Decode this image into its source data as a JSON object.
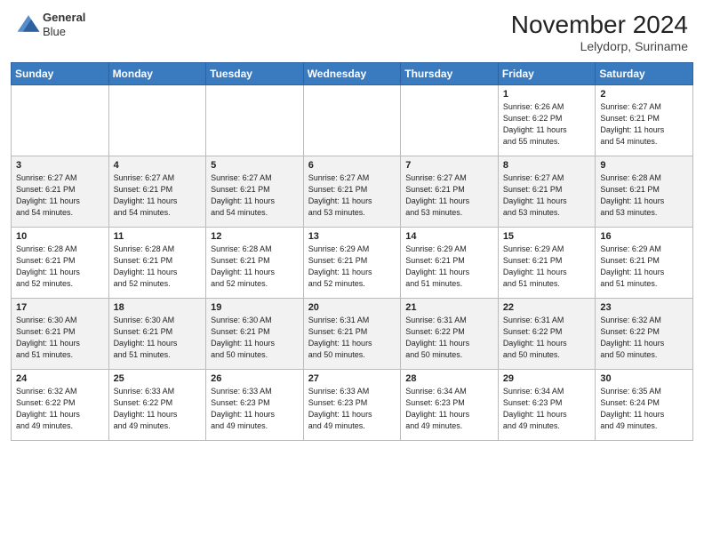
{
  "header": {
    "logo_line1": "General",
    "logo_line2": "Blue",
    "month_year": "November 2024",
    "location": "Lelydorp, Suriname"
  },
  "weekdays": [
    "Sunday",
    "Monday",
    "Tuesday",
    "Wednesday",
    "Thursday",
    "Friday",
    "Saturday"
  ],
  "weeks": [
    [
      {
        "day": "",
        "info": ""
      },
      {
        "day": "",
        "info": ""
      },
      {
        "day": "",
        "info": ""
      },
      {
        "day": "",
        "info": ""
      },
      {
        "day": "",
        "info": ""
      },
      {
        "day": "1",
        "info": "Sunrise: 6:26 AM\nSunset: 6:22 PM\nDaylight: 11 hours\nand 55 minutes."
      },
      {
        "day": "2",
        "info": "Sunrise: 6:27 AM\nSunset: 6:21 PM\nDaylight: 11 hours\nand 54 minutes."
      }
    ],
    [
      {
        "day": "3",
        "info": "Sunrise: 6:27 AM\nSunset: 6:21 PM\nDaylight: 11 hours\nand 54 minutes."
      },
      {
        "day": "4",
        "info": "Sunrise: 6:27 AM\nSunset: 6:21 PM\nDaylight: 11 hours\nand 54 minutes."
      },
      {
        "day": "5",
        "info": "Sunrise: 6:27 AM\nSunset: 6:21 PM\nDaylight: 11 hours\nand 54 minutes."
      },
      {
        "day": "6",
        "info": "Sunrise: 6:27 AM\nSunset: 6:21 PM\nDaylight: 11 hours\nand 53 minutes."
      },
      {
        "day": "7",
        "info": "Sunrise: 6:27 AM\nSunset: 6:21 PM\nDaylight: 11 hours\nand 53 minutes."
      },
      {
        "day": "8",
        "info": "Sunrise: 6:27 AM\nSunset: 6:21 PM\nDaylight: 11 hours\nand 53 minutes."
      },
      {
        "day": "9",
        "info": "Sunrise: 6:28 AM\nSunset: 6:21 PM\nDaylight: 11 hours\nand 53 minutes."
      }
    ],
    [
      {
        "day": "10",
        "info": "Sunrise: 6:28 AM\nSunset: 6:21 PM\nDaylight: 11 hours\nand 52 minutes."
      },
      {
        "day": "11",
        "info": "Sunrise: 6:28 AM\nSunset: 6:21 PM\nDaylight: 11 hours\nand 52 minutes."
      },
      {
        "day": "12",
        "info": "Sunrise: 6:28 AM\nSunset: 6:21 PM\nDaylight: 11 hours\nand 52 minutes."
      },
      {
        "day": "13",
        "info": "Sunrise: 6:29 AM\nSunset: 6:21 PM\nDaylight: 11 hours\nand 52 minutes."
      },
      {
        "day": "14",
        "info": "Sunrise: 6:29 AM\nSunset: 6:21 PM\nDaylight: 11 hours\nand 51 minutes."
      },
      {
        "day": "15",
        "info": "Sunrise: 6:29 AM\nSunset: 6:21 PM\nDaylight: 11 hours\nand 51 minutes."
      },
      {
        "day": "16",
        "info": "Sunrise: 6:29 AM\nSunset: 6:21 PM\nDaylight: 11 hours\nand 51 minutes."
      }
    ],
    [
      {
        "day": "17",
        "info": "Sunrise: 6:30 AM\nSunset: 6:21 PM\nDaylight: 11 hours\nand 51 minutes."
      },
      {
        "day": "18",
        "info": "Sunrise: 6:30 AM\nSunset: 6:21 PM\nDaylight: 11 hours\nand 51 minutes."
      },
      {
        "day": "19",
        "info": "Sunrise: 6:30 AM\nSunset: 6:21 PM\nDaylight: 11 hours\nand 50 minutes."
      },
      {
        "day": "20",
        "info": "Sunrise: 6:31 AM\nSunset: 6:21 PM\nDaylight: 11 hours\nand 50 minutes."
      },
      {
        "day": "21",
        "info": "Sunrise: 6:31 AM\nSunset: 6:22 PM\nDaylight: 11 hours\nand 50 minutes."
      },
      {
        "day": "22",
        "info": "Sunrise: 6:31 AM\nSunset: 6:22 PM\nDaylight: 11 hours\nand 50 minutes."
      },
      {
        "day": "23",
        "info": "Sunrise: 6:32 AM\nSunset: 6:22 PM\nDaylight: 11 hours\nand 50 minutes."
      }
    ],
    [
      {
        "day": "24",
        "info": "Sunrise: 6:32 AM\nSunset: 6:22 PM\nDaylight: 11 hours\nand 49 minutes."
      },
      {
        "day": "25",
        "info": "Sunrise: 6:33 AM\nSunset: 6:22 PM\nDaylight: 11 hours\nand 49 minutes."
      },
      {
        "day": "26",
        "info": "Sunrise: 6:33 AM\nSunset: 6:23 PM\nDaylight: 11 hours\nand 49 minutes."
      },
      {
        "day": "27",
        "info": "Sunrise: 6:33 AM\nSunset: 6:23 PM\nDaylight: 11 hours\nand 49 minutes."
      },
      {
        "day": "28",
        "info": "Sunrise: 6:34 AM\nSunset: 6:23 PM\nDaylight: 11 hours\nand 49 minutes."
      },
      {
        "day": "29",
        "info": "Sunrise: 6:34 AM\nSunset: 6:23 PM\nDaylight: 11 hours\nand 49 minutes."
      },
      {
        "day": "30",
        "info": "Sunrise: 6:35 AM\nSunset: 6:24 PM\nDaylight: 11 hours\nand 49 minutes."
      }
    ]
  ]
}
